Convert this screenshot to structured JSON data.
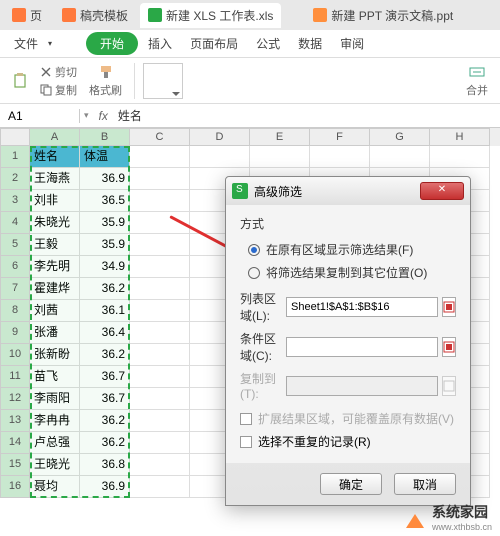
{
  "tabs": [
    {
      "label": "页",
      "icon": "d"
    },
    {
      "label": "稿壳模板",
      "icon": "d"
    },
    {
      "label": "新建 XLS 工作表.xls",
      "icon": "s",
      "active": true
    },
    {
      "label": "新建 PPT 演示文稿.ppt",
      "icon": "p"
    }
  ],
  "menu": {
    "file": "文件",
    "start": "开始",
    "insert": "插入",
    "layout": "页面布局",
    "formula": "公式",
    "data": "数据",
    "review": "审阅"
  },
  "toolbar": {
    "cut": "剪切",
    "copy": "复制",
    "format_painter": "格式刷",
    "merge": "合并"
  },
  "formula_bar": {
    "cell_ref": "A1",
    "value": "姓名"
  },
  "columns": [
    "A",
    "B",
    "C",
    "D",
    "E",
    "F",
    "G",
    "H"
  ],
  "table": {
    "header": {
      "name": "姓名",
      "temp": "体温"
    },
    "rows": [
      {
        "name": "王海燕",
        "temp": "36.9"
      },
      {
        "name": "刘非",
        "temp": "36.5"
      },
      {
        "name": "朱晓光",
        "temp": "35.9"
      },
      {
        "name": "王毅",
        "temp": "35.9"
      },
      {
        "name": "李先明",
        "temp": "34.9"
      },
      {
        "name": "霍建烨",
        "temp": "36.2"
      },
      {
        "name": "刘茜",
        "temp": "36.1"
      },
      {
        "name": "张潘",
        "temp": "36.4"
      },
      {
        "name": "张新盼",
        "temp": "36.2"
      },
      {
        "name": "苗飞",
        "temp": "36.7"
      },
      {
        "name": "李雨阳",
        "temp": "36.7"
      },
      {
        "name": "李冉冉",
        "temp": "36.2"
      },
      {
        "name": "卢总强",
        "temp": "36.2"
      },
      {
        "name": "王晓光",
        "temp": "36.8"
      },
      {
        "name": "聂均",
        "temp": "36.9"
      }
    ]
  },
  "dialog": {
    "title": "高级筛选",
    "method_label": "方式",
    "opt_inplace": "在原有区域显示筛选结果(F)",
    "opt_copy": "将筛选结果复制到其它位置(O)",
    "list_range_label": "列表区域(L):",
    "list_range_value": "Sheet1!$A$1:$B$16",
    "criteria_label": "条件区域(C):",
    "copy_to_label": "复制到(T):",
    "check_extend": "扩展结果区域，可能覆盖原有数据(V)",
    "check_unique": "选择不重复的记录(R)",
    "ok": "确定",
    "cancel": "取消"
  },
  "watermark": {
    "brand": "系统家园",
    "url": "www.xthbsb.cn"
  }
}
